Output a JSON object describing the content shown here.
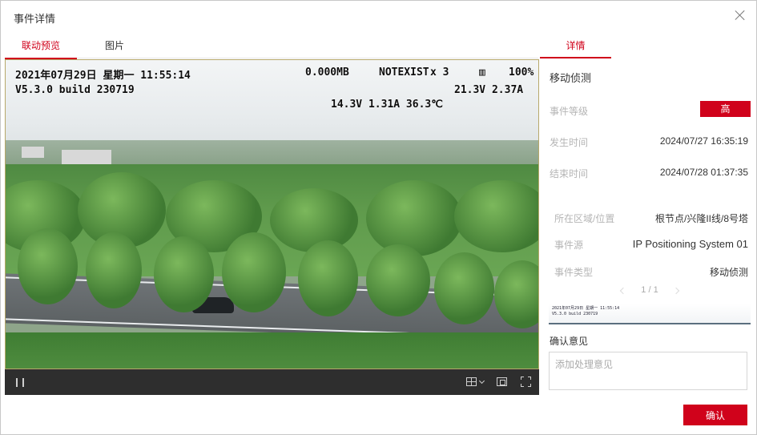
{
  "dialog": {
    "title": "事件详情"
  },
  "tabs": {
    "preview": "联动预览",
    "image": "图片",
    "details": "详情"
  },
  "osd": {
    "line1_datetime": "2021年07月29日 星期一 11:55:14",
    "line1_data": "0.000MB",
    "line1_net": "NOTEXIST",
    "line1_net_count": "x 3",
    "line1_battery": "100%",
    "line2_version": "V5.3.0 build 230719",
    "line2_power": "21.3V 2.37A",
    "line3_readout": "14.3V   1.31A   36.3℃"
  },
  "event": {
    "name": "移动侦测",
    "level_label": "事件等级",
    "level_value": "高",
    "start_label": "发生时间",
    "start_value": "2024/07/27 16:35:19",
    "end_label": "结束时间",
    "end_value": "2024/07/28 01:37:35",
    "area_label": "所在区域/位置",
    "area_value": "根节点/兴隆II线/8号塔",
    "source_label": "事件源",
    "source_value": "IP Positioning System 01",
    "type_label": "事件类型",
    "type_value": "移动侦测"
  },
  "pager": {
    "text": "1 / 1"
  },
  "confirm": {
    "label": "确认意见",
    "placeholder": "添加处理意见",
    "button": "确认"
  },
  "colors": {
    "accent": "#d0021b"
  }
}
